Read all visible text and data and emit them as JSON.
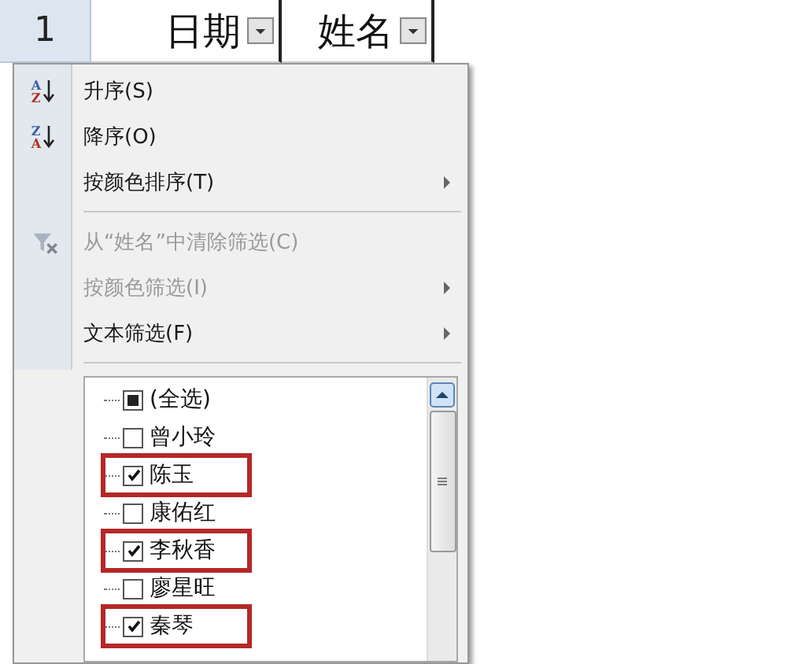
{
  "sheet": {
    "row_header": "1",
    "columns": [
      {
        "label": "日期"
      },
      {
        "label": "姓名"
      }
    ]
  },
  "menu": {
    "items": [
      {
        "kind": "sort",
        "label": "升序(S)",
        "icon_letters": [
          "A",
          "Z"
        ],
        "disabled": false,
        "submenu": false
      },
      {
        "kind": "sort",
        "label": "降序(O)",
        "icon_letters": [
          "Z",
          "A"
        ],
        "disabled": false,
        "submenu": false
      },
      {
        "kind": "item",
        "label": "按颜色排序(T)",
        "disabled": false,
        "submenu": true
      },
      {
        "kind": "separator"
      },
      {
        "kind": "clear",
        "label": "从“姓名”中清除筛选(C)",
        "disabled": true,
        "submenu": false
      },
      {
        "kind": "item",
        "label": "按颜色筛选(I)",
        "disabled": true,
        "submenu": true
      },
      {
        "kind": "item",
        "label": "文本筛选(F)",
        "disabled": false,
        "submenu": true
      },
      {
        "kind": "separator"
      }
    ],
    "list": {
      "items": [
        {
          "label": "(全选)",
          "checked": false,
          "indeterminate": true,
          "highlighted": false
        },
        {
          "label": "曾小玲",
          "checked": false,
          "indeterminate": false,
          "highlighted": false
        },
        {
          "label": "陈玉",
          "checked": true,
          "indeterminate": false,
          "highlighted": true
        },
        {
          "label": "康佑红",
          "checked": false,
          "indeterminate": false,
          "highlighted": false
        },
        {
          "label": "李秋香",
          "checked": true,
          "indeterminate": false,
          "highlighted": true
        },
        {
          "label": "廖星旺",
          "checked": false,
          "indeterminate": false,
          "highlighted": false
        },
        {
          "label": "秦琴",
          "checked": true,
          "indeterminate": false,
          "highlighted": true
        }
      ]
    }
  }
}
